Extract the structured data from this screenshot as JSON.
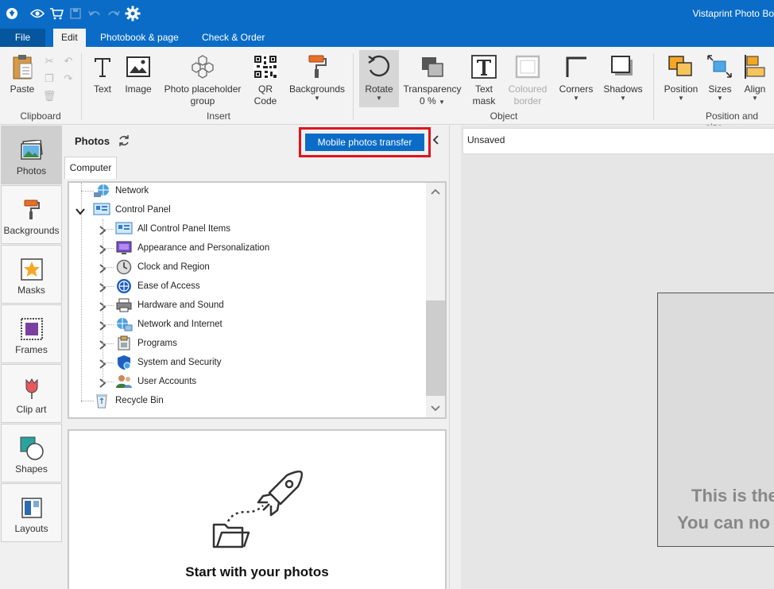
{
  "app": {
    "title": "Vistaprint Photo Bo"
  },
  "menu": {
    "file": "File",
    "edit": "Edit",
    "photobook": "Photobook & page",
    "check": "Check & Order"
  },
  "ribbon": {
    "paste": "Paste",
    "text": "Text",
    "image": "Image",
    "placeholder_line1": "Photo placeholder",
    "placeholder_line2": "group",
    "qr_line1": "QR",
    "qr_line2": "Code",
    "backgrounds": "Backgrounds",
    "rotate": "Rotate",
    "transparency": "Transparency",
    "transparency_value": "0 %",
    "textmask_line1": "Text",
    "textmask_line2": "mask",
    "coloured_line1": "Coloured",
    "coloured_line2": "border",
    "corners": "Corners",
    "shadows": "Shadows",
    "position": "Position",
    "sizes": "Sizes",
    "align": "Align",
    "groups": {
      "clipboard": "Clipboard",
      "insert": "Insert",
      "object": "Object",
      "position": "Position and size"
    }
  },
  "sidebar": {
    "items": [
      {
        "label": "Photos",
        "icon": "photos-icon"
      },
      {
        "label": "Backgrounds",
        "icon": "roller-icon"
      },
      {
        "label": "Masks",
        "icon": "star-icon"
      },
      {
        "label": "Frames",
        "icon": "frame-icon"
      },
      {
        "label": "Clip art",
        "icon": "tulip-icon"
      },
      {
        "label": "Shapes",
        "icon": "shapes-icon"
      },
      {
        "label": "Layouts",
        "icon": "layouts-icon"
      }
    ]
  },
  "panel": {
    "title": "Photos",
    "mobile_button": "Mobile photos transfer",
    "tab": "Computer",
    "tree": {
      "network": "Network",
      "control_panel": "Control Panel",
      "children": [
        "All Control Panel Items",
        "Appearance and Personalization",
        "Clock and Region",
        "Ease of Access",
        "Hardware and Sound",
        "Network and Internet",
        "Programs",
        "System and Security",
        "User Accounts"
      ],
      "recycle": "Recycle Bin"
    },
    "dropzone_heading": "Start with your photos"
  },
  "canvas": {
    "doc_name": "Unsaved",
    "page_line1": "This is the",
    "page_line2": "You can no"
  },
  "colors": {
    "accent": "#0a6cc6",
    "highlight": "#e0141e"
  }
}
